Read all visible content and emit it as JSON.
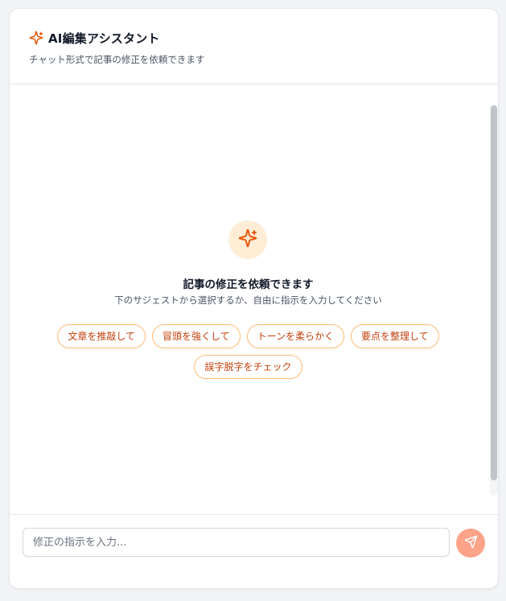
{
  "header": {
    "title": "AI編集アシスタント",
    "subtitle": "チャット形式で記事の修正を依頼できます",
    "icon": "sparkles-icon"
  },
  "empty_state": {
    "icon": "sparkles-icon",
    "title": "記事の修正を依頼できます",
    "description": "下のサジェストから選択するか、自由に指示を入力してください"
  },
  "suggestions": [
    "文章を推敲して",
    "冒頭を強くして",
    "トーンを柔らかく",
    "要点を整理して",
    "誤字脱字をチェック"
  ],
  "composer": {
    "placeholder": "修正の指示を入力...",
    "value": "",
    "send_icon": "send-icon"
  },
  "colors": {
    "accent": "#ea580c",
    "accent_soft": "#ffedd5",
    "chip_border": "#fdba74",
    "send_button": "#fca389"
  }
}
